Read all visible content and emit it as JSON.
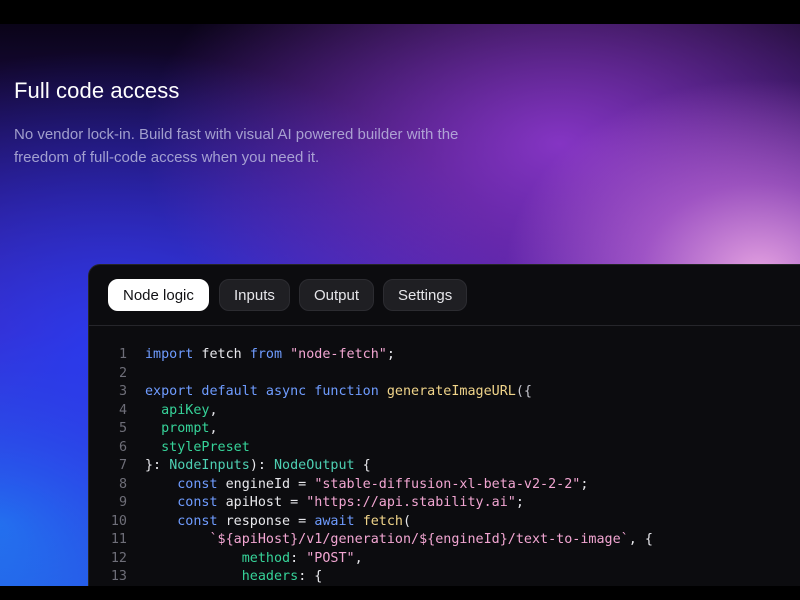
{
  "hero": {
    "title": "Full code access",
    "subtitle_line1": "No vendor lock-in. Build fast with visual AI powered builder with the",
    "subtitle_line2": "freedom of full-code access when you need it."
  },
  "colors": {
    "tab_active_bg": "#ffffff",
    "tab_bg": "#1f1f23",
    "editor_bg": "#0c0c0f",
    "keyword": "#6f9cff",
    "string": "#f2a6d2",
    "function": "#f0d48a",
    "type": "#4ed0b3"
  },
  "editor": {
    "tabs": [
      {
        "label": "Node logic",
        "active": true
      },
      {
        "label": "Inputs",
        "active": false
      },
      {
        "label": "Output",
        "active": false
      },
      {
        "label": "Settings",
        "active": false
      }
    ],
    "lines": [
      {
        "n": "1",
        "tokens": [
          [
            "kw",
            "import"
          ],
          [
            "plain",
            " fetch "
          ],
          [
            "kw",
            "from"
          ],
          [
            "plain",
            " "
          ],
          [
            "str",
            "\"node-fetch\""
          ],
          [
            "plain",
            ";"
          ]
        ]
      },
      {
        "n": "2",
        "tokens": []
      },
      {
        "n": "3",
        "tokens": [
          [
            "kw",
            "export default async function"
          ],
          [
            "plain",
            " "
          ],
          [
            "fn",
            "generateImageURL"
          ],
          [
            "punc",
            "({"
          ]
        ]
      },
      {
        "n": "4",
        "tokens": [
          [
            "plain",
            "  "
          ],
          [
            "param",
            "apiKey"
          ],
          [
            "plain",
            ","
          ]
        ]
      },
      {
        "n": "5",
        "tokens": [
          [
            "plain",
            "  "
          ],
          [
            "param",
            "prompt"
          ],
          [
            "plain",
            ","
          ]
        ]
      },
      {
        "n": "6",
        "tokens": [
          [
            "plain",
            "  "
          ],
          [
            "param",
            "stylePreset"
          ]
        ]
      },
      {
        "n": "7",
        "tokens": [
          [
            "plain",
            "}: "
          ],
          [
            "type",
            "NodeInputs"
          ],
          [
            "plain",
            "): "
          ],
          [
            "type",
            "NodeOutput"
          ],
          [
            "plain",
            " {"
          ]
        ]
      },
      {
        "n": "8",
        "tokens": [
          [
            "plain",
            "    "
          ],
          [
            "kw",
            "const"
          ],
          [
            "plain",
            " engineId = "
          ],
          [
            "str",
            "\"stable-diffusion-xl-beta-v2-2-2\""
          ],
          [
            "plain",
            ";"
          ]
        ]
      },
      {
        "n": "9",
        "tokens": [
          [
            "plain",
            "    "
          ],
          [
            "kw",
            "const"
          ],
          [
            "plain",
            " apiHost = "
          ],
          [
            "str",
            "\"https://api.stability.ai\""
          ],
          [
            "plain",
            ";"
          ]
        ]
      },
      {
        "n": "10",
        "tokens": [
          [
            "plain",
            "    "
          ],
          [
            "kw",
            "const"
          ],
          [
            "plain",
            " response = "
          ],
          [
            "kw",
            "await"
          ],
          [
            "plain",
            " "
          ],
          [
            "fn",
            "fetch"
          ],
          [
            "plain",
            "("
          ]
        ]
      },
      {
        "n": "11",
        "tokens": [
          [
            "plain",
            "        "
          ],
          [
            "str",
            "`${apiHost}/v1/generation/${engineId}/text-to-image`"
          ],
          [
            "plain",
            ", {"
          ]
        ]
      },
      {
        "n": "12",
        "tokens": [
          [
            "plain",
            "            "
          ],
          [
            "param",
            "method"
          ],
          [
            "plain",
            ": "
          ],
          [
            "str",
            "\"POST\""
          ],
          [
            "plain",
            ","
          ]
        ]
      },
      {
        "n": "13",
        "tokens": [
          [
            "plain",
            "            "
          ],
          [
            "param",
            "headers"
          ],
          [
            "plain",
            ": {"
          ]
        ]
      }
    ]
  }
}
